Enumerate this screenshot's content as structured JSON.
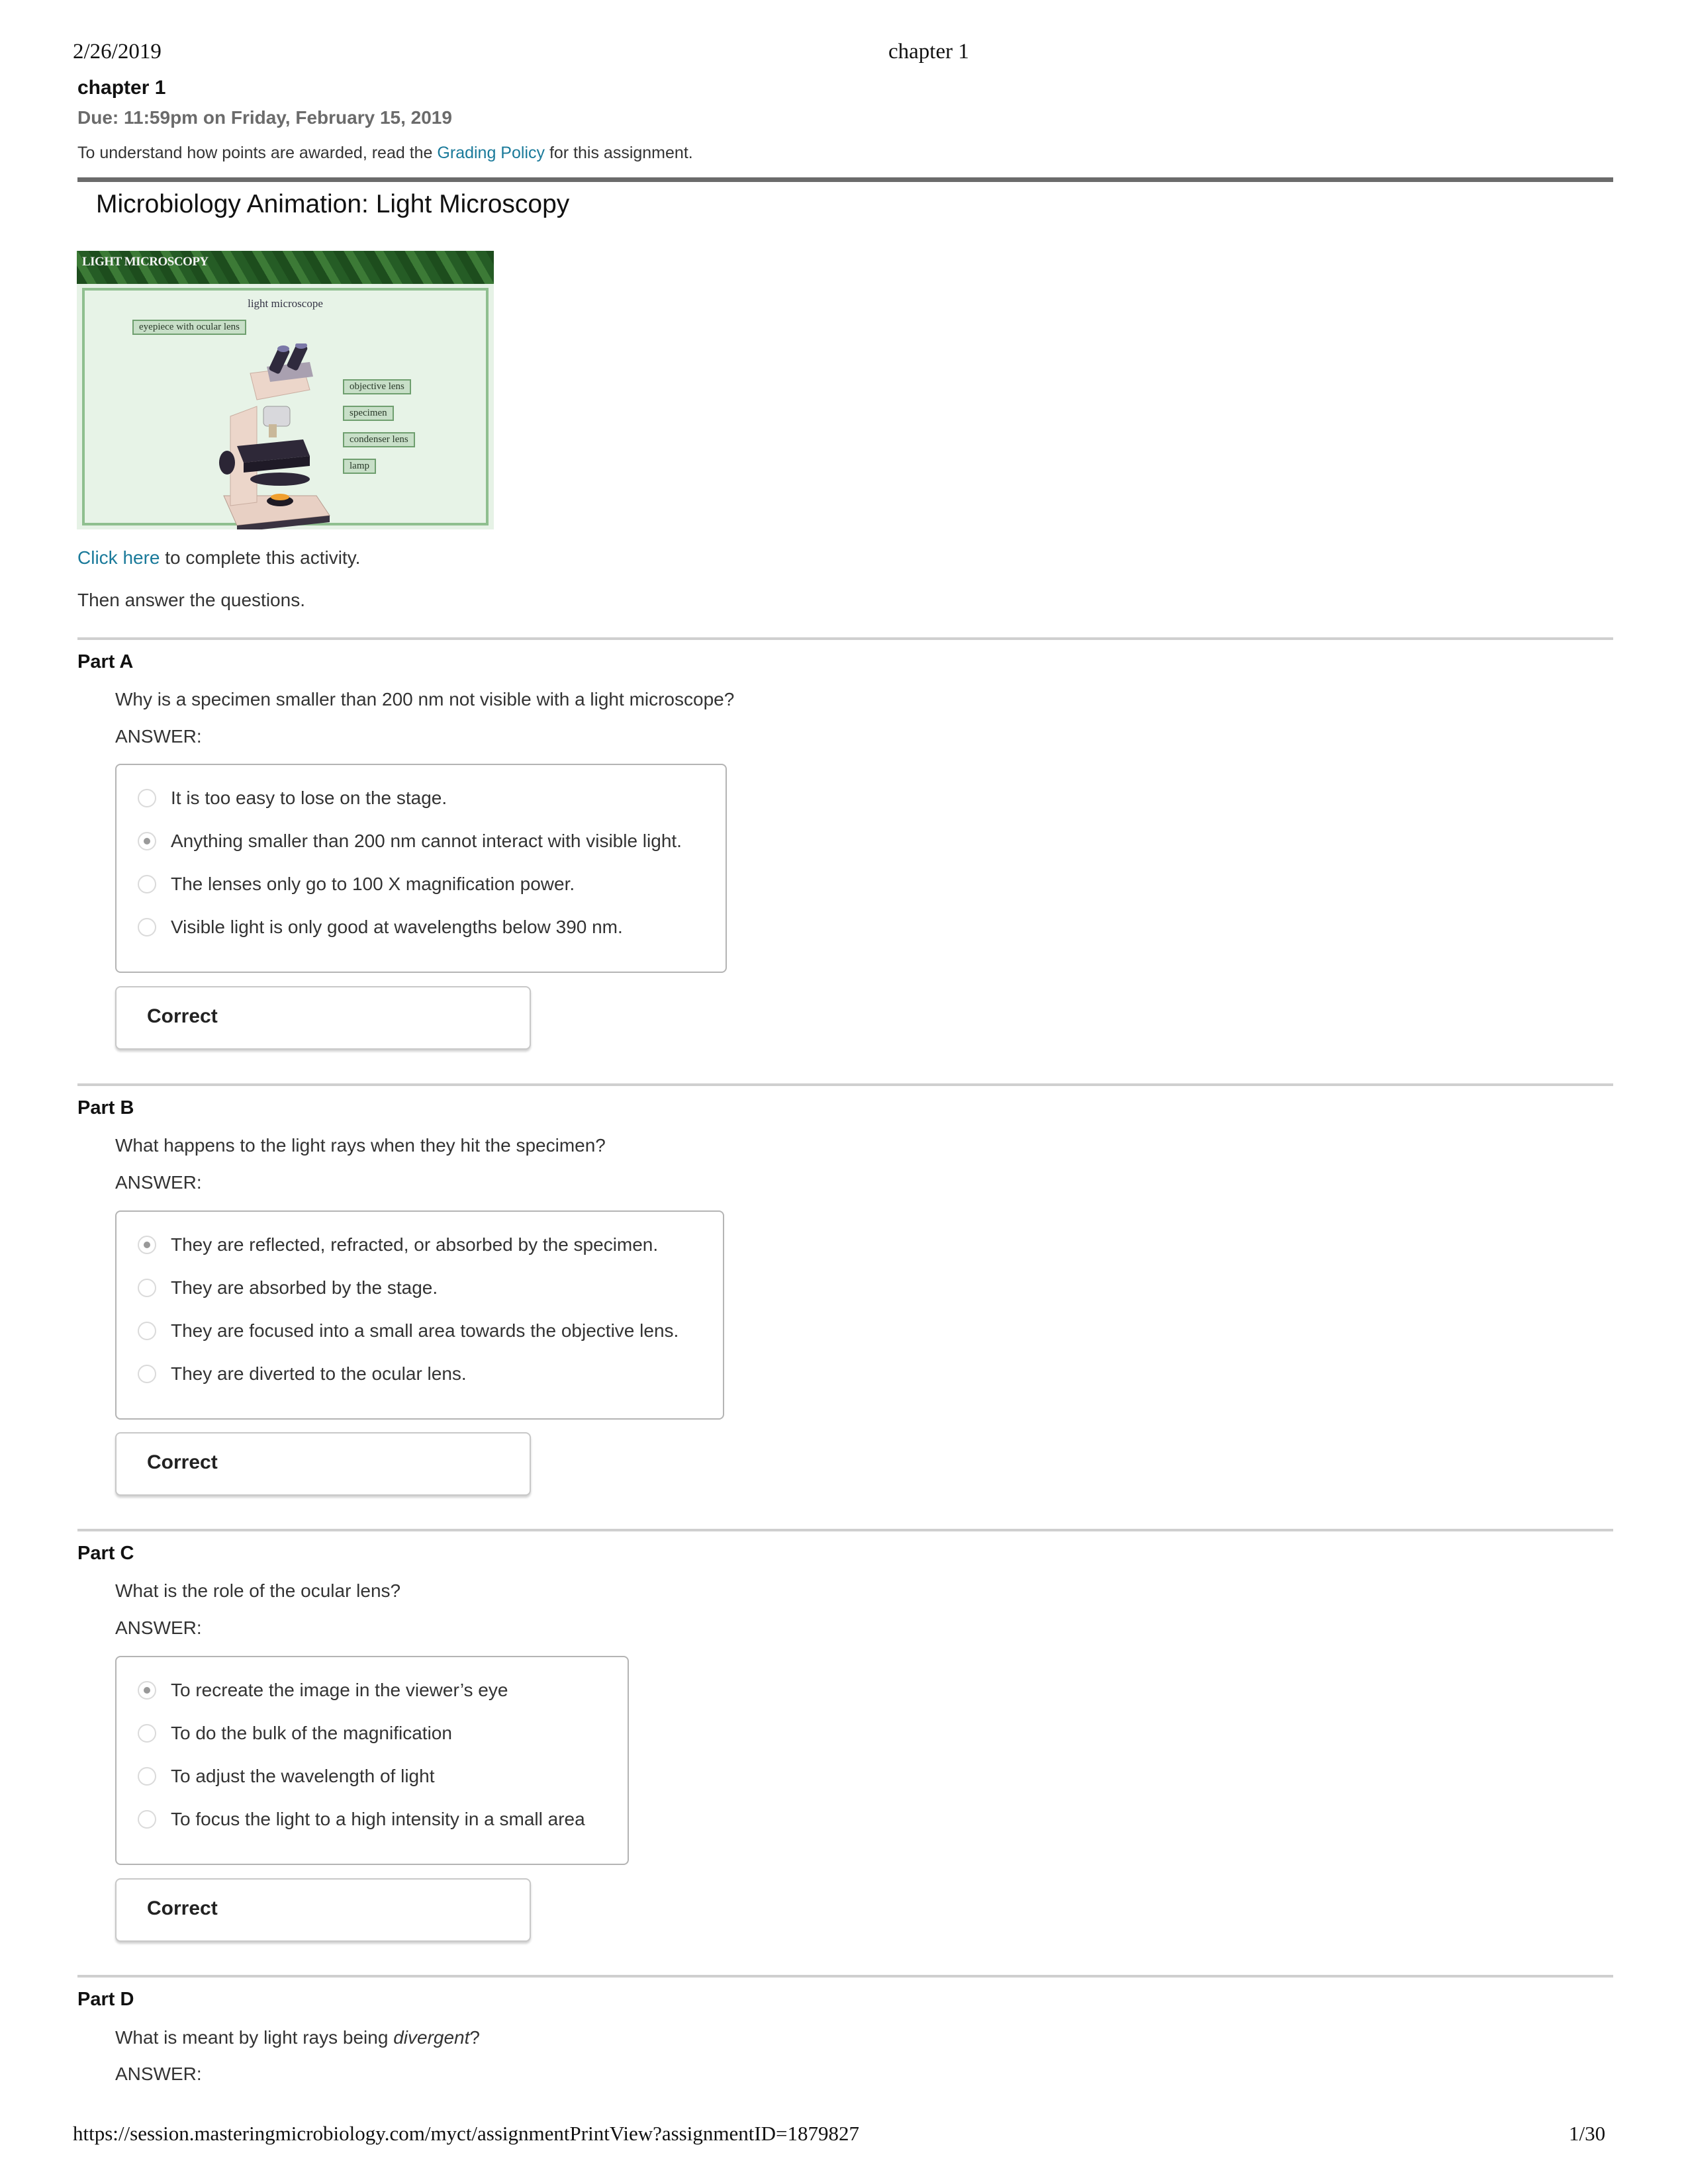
{
  "print_header": {
    "date": "2/26/2019",
    "title": "chapter 1"
  },
  "assignment": {
    "title": "chapter 1",
    "due": "Due: 11:59pm on Friday, February 15, 2019",
    "policy_prefix": "To understand how points are awarded, read the ",
    "policy_link": "Grading Policy",
    "policy_suffix": " for this assignment."
  },
  "section": {
    "title": "Microbiology Animation: Light Microscopy",
    "image": {
      "header": "LIGHT MICROSCOPY",
      "caption": "light microscope",
      "labels": [
        "eyepiece with ocular lens",
        "objective lens",
        "specimen",
        "condenser lens",
        "lamp"
      ]
    },
    "click_link": "Click here",
    "click_suffix": " to complete this activity.",
    "then_text": "Then answer the questions."
  },
  "parts": [
    {
      "label": "Part A",
      "question": "Why is a specimen smaller than 200 nm not visible with a light microscope?",
      "answer_label": "ANSWER:",
      "options": [
        {
          "text": "It is too easy to lose on the stage.",
          "selected": false
        },
        {
          "text": "Anything smaller than 200 nm cannot interact with visible light.",
          "selected": true
        },
        {
          "text": "The lenses only go to 100 X magnification power.",
          "selected": false
        },
        {
          "text": "Visible light is only good at wavelengths below 390 nm.",
          "selected": false
        }
      ],
      "result": "Correct"
    },
    {
      "label": "Part B",
      "question": "What happens to the light rays when they hit the specimen?",
      "answer_label": "ANSWER:",
      "options": [
        {
          "text": "They are reflected, refracted, or absorbed by the specimen.",
          "selected": true
        },
        {
          "text": "They are absorbed by the stage.",
          "selected": false
        },
        {
          "text": "They are focused into a small area towards the objective lens.",
          "selected": false
        },
        {
          "text": "They are diverted to the ocular lens.",
          "selected": false
        }
      ],
      "result": "Correct"
    },
    {
      "label": "Part C",
      "question": "What is the role of the ocular lens?",
      "answer_label": "ANSWER:",
      "options": [
        {
          "text": "To recreate the image in the viewer’s eye",
          "selected": true
        },
        {
          "text": "To do the bulk of the magnification",
          "selected": false
        },
        {
          "text": "To adjust the wavelength of light",
          "selected": false
        },
        {
          "text": "To focus the light to a high intensity in a small area",
          "selected": false
        }
      ],
      "result": "Correct"
    },
    {
      "label": "Part D",
      "question_prefix": "What is meant by light rays being ",
      "question_emphasis": "divergent",
      "question_suffix": "?",
      "answer_label": "ANSWER:"
    }
  ],
  "print_footer": {
    "url": "https://session.masteringmicrobiology.com/myct/assignmentPrintView?assignmentID=1879827",
    "page": "1/30"
  }
}
